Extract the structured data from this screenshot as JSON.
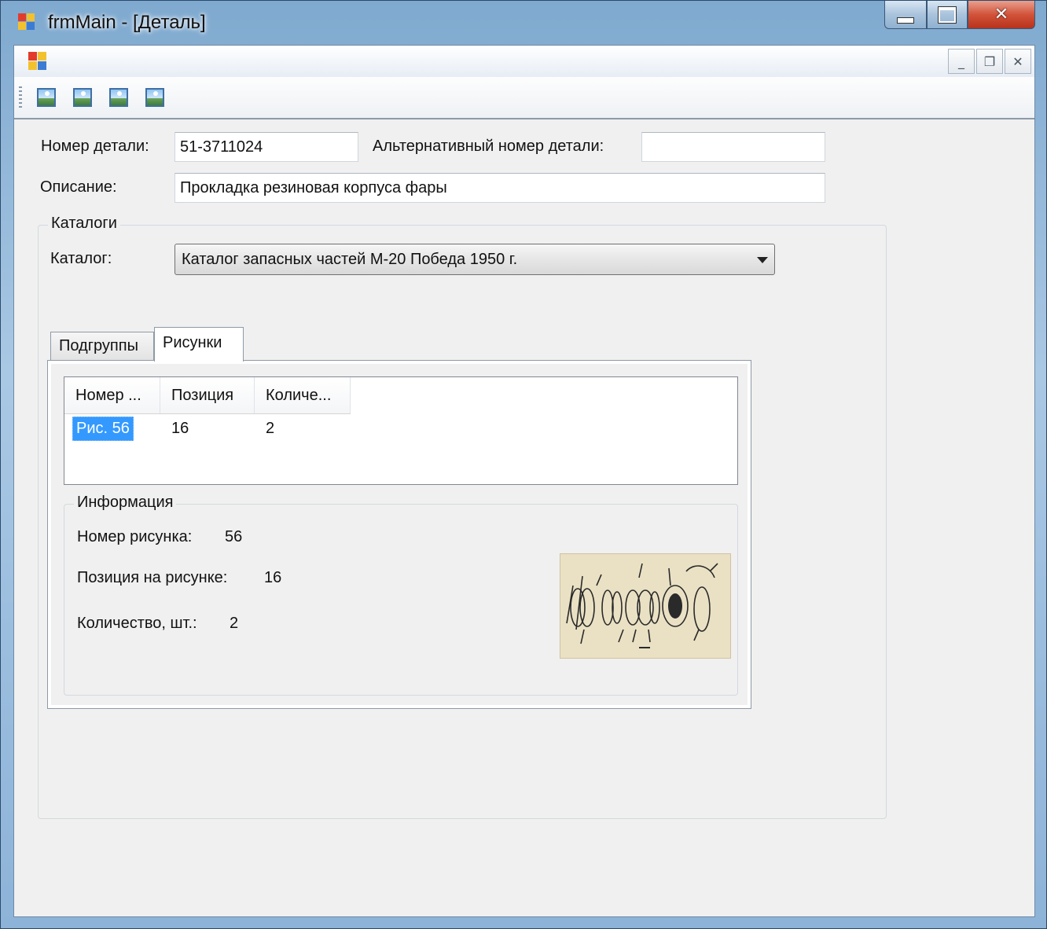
{
  "window": {
    "title": "frmMain - [Деталь]"
  },
  "toolbar": {
    "buttons": [
      "image-icon",
      "image-icon",
      "image-icon",
      "image-icon"
    ]
  },
  "form": {
    "part_number_label": "Номер детали:",
    "part_number_value": "51-3711024",
    "alt_number_label": "Альтернативный номер детали:",
    "alt_number_value": "",
    "description_label": "Описание:",
    "description_value": "Прокладка резиновая корпуса фары"
  },
  "catalogs": {
    "group_title": "Каталоги",
    "catalog_label": "Каталог:",
    "catalog_selected": "Каталог запасных частей М-20 Победа 1950 г.",
    "tabs": [
      {
        "label": "Подгруппы",
        "active": false
      },
      {
        "label": "Рисунки",
        "active": true
      }
    ]
  },
  "figures_list": {
    "columns": [
      "Номер ...",
      "Позиция",
      "Количе..."
    ],
    "rows": [
      {
        "number": "Рис. 56",
        "position": "16",
        "quantity": "2",
        "selected": true
      }
    ]
  },
  "info": {
    "group_title": "Информация",
    "figure_number_label": "Номер рисунка:",
    "figure_number_value": "56",
    "position_label": "Позиция на рисунке:",
    "position_value": "16",
    "quantity_label": "Количество, шт.:",
    "quantity_value": "2"
  },
  "colors": {
    "selection": "#3399ff",
    "close_button": "#c7452c"
  }
}
